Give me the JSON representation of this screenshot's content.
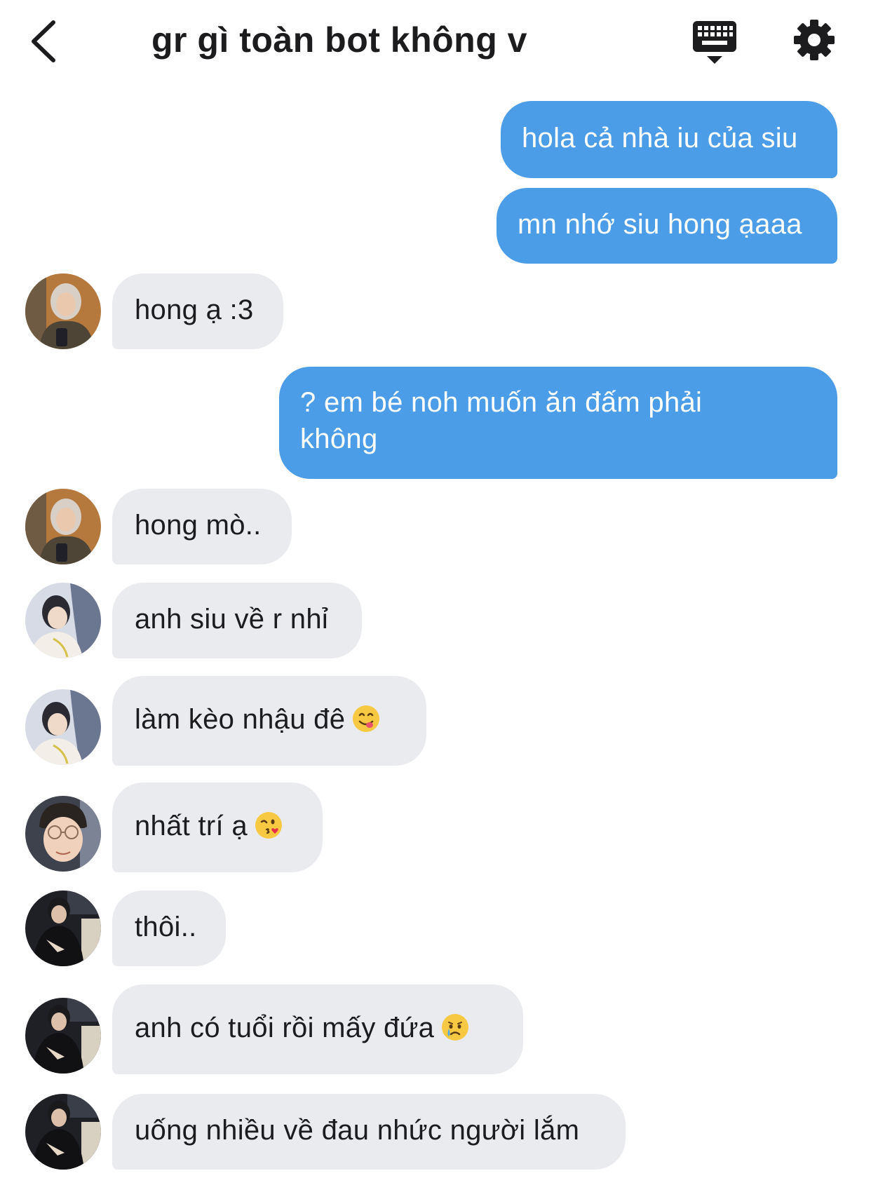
{
  "header": {
    "title": "gr gì toàn bot không v",
    "back_icon": "chevron-left-icon",
    "keyboard_icon": "keyboard-icon",
    "settings_icon": "gear-icon"
  },
  "colors": {
    "outgoing_bubble": "#4c9de8",
    "incoming_bubble": "#eaebee",
    "background": "#ffffff"
  },
  "messages": [
    {
      "direction": "out",
      "text": "hola cả nhà iu của siu"
    },
    {
      "direction": "out",
      "text": "mn nhớ siu hong ạaaa"
    },
    {
      "direction": "in",
      "sender_avatar": "avatar-hooded",
      "text": "hong ạ :3"
    },
    {
      "direction": "out",
      "line1": "? em bé noh muốn ăn đấm phải",
      "line2": "không"
    },
    {
      "direction": "in",
      "sender_avatar": "avatar-hooded",
      "text": "hong mò.."
    },
    {
      "direction": "in",
      "sender_avatar": "avatar-flowers",
      "text": "anh siu về r nhỉ"
    },
    {
      "direction": "in",
      "sender_avatar": "avatar-flowers",
      "text": "làm kèo nhậu đê",
      "emoji": "yum-face-emoji"
    },
    {
      "direction": "in",
      "sender_avatar": "avatar-glasses",
      "text": "nhất trí ạ",
      "emoji": "kissing-wink-face-emoji"
    },
    {
      "direction": "in",
      "sender_avatar": "avatar-dark",
      "text": "thôi.."
    },
    {
      "direction": "in",
      "sender_avatar": "avatar-dark",
      "text": "anh có tuổi rồi mấy đứa",
      "emoji": "crying-face-emoji"
    },
    {
      "direction": "in",
      "sender_avatar": "avatar-dark",
      "text": "uống nhiều về đau nhức người lắm"
    }
  ]
}
